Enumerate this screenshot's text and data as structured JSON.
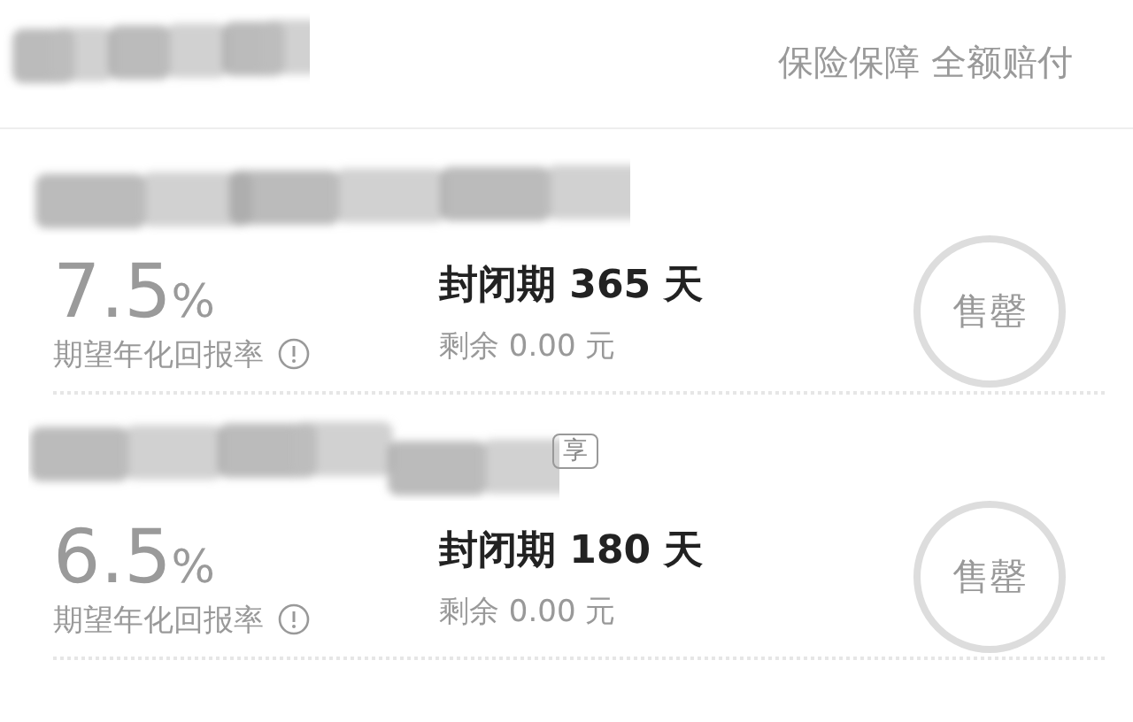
{
  "header": {
    "note": "保险保障 全额赔付"
  },
  "products": [
    {
      "rate": "7.5",
      "rate_unit": "%",
      "rate_label": "期望年化回报率",
      "term": "封闭期 365 天",
      "remaining": "剩余 0.00 元",
      "status": "售罄"
    },
    {
      "tag": "享",
      "rate": "6.5",
      "rate_unit": "%",
      "rate_label": "期望年化回报率",
      "term": "封闭期 180 天",
      "remaining": "剩余 0.00 元",
      "status": "售罄"
    }
  ]
}
